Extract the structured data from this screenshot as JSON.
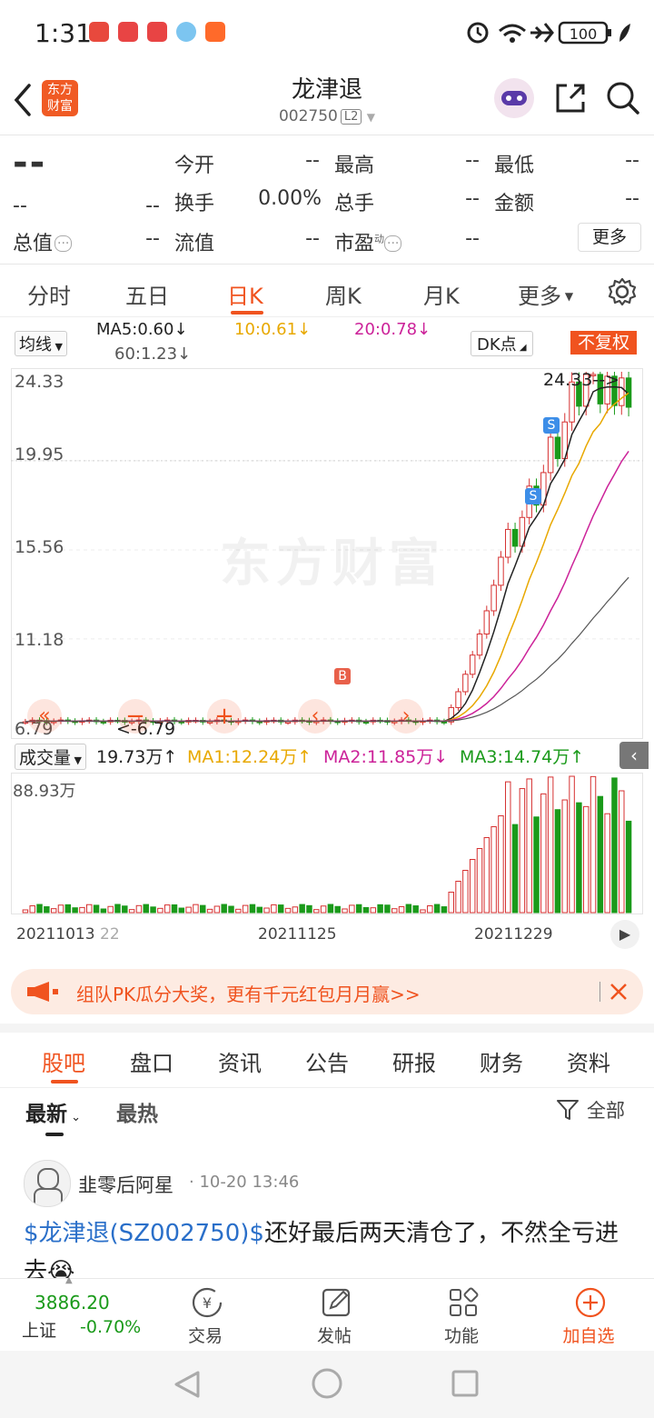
{
  "status_bar": {
    "time": "1:31",
    "battery": "100"
  },
  "header": {
    "title": "龙津退",
    "code": "002750",
    "level": "L2",
    "logo_text": "东方财富"
  },
  "quote": {
    "price": "--",
    "change": "--",
    "change_pct": "--",
    "market_cap_label": "总值",
    "market_cap": "--",
    "fields": [
      {
        "label": "今开",
        "value": "--"
      },
      {
        "label": "最高",
        "value": "--"
      },
      {
        "label": "最低",
        "value": "--"
      },
      {
        "label": "换手",
        "value": "0.00%"
      },
      {
        "label": "总手",
        "value": "--"
      },
      {
        "label": "金额",
        "value": "--"
      },
      {
        "label": "流值",
        "value": "--"
      },
      {
        "label": "市盈",
        "label_sup": "动",
        "value": "--"
      }
    ],
    "more_label": "更多"
  },
  "period_tabs": [
    "分时",
    "五日",
    "日K",
    "周K",
    "月K",
    "更多"
  ],
  "active_period": "日K",
  "ma_bar": {
    "selector": "均线",
    "ma5": "MA5:0.60↓",
    "ma10": "10:0.61↓",
    "ma20": "20:0.78↓",
    "ma60": "60:1.23↓",
    "dk_label": "DK点",
    "adjust_label": "不复权"
  },
  "kline": {
    "y_labels": [
      "24.33",
      "19.95",
      "15.56",
      "11.18",
      "6.79"
    ],
    "max_marker": "24.33",
    "min_marker": "6.79",
    "watermark": "东方财富",
    "signals": [
      "S",
      "S",
      "B"
    ]
  },
  "volume_bar": {
    "selector": "成交量",
    "value": "19.73万↑",
    "ma1": "MA1:12.24万↑",
    "ma2": "MA2:11.85万↓",
    "ma3": "MA3:14.74万↑",
    "y_max": "88.93万"
  },
  "dates": [
    "20211013",
    "22",
    "20211125",
    "20211229"
  ],
  "banner": {
    "text": "组队PK瓜分大奖，更有千元红包月月赢>>"
  },
  "bottom_tabs": [
    "股吧",
    "盘口",
    "资讯",
    "公告",
    "研报",
    "财务",
    "资料"
  ],
  "active_bottom_tab": "股吧",
  "sort": {
    "latest": "最新",
    "hot": "最热",
    "filter": "全部"
  },
  "post": {
    "user": "韭零后阿星",
    "time": "10-20 13:46",
    "tag": "$龙津退(SZ002750)$",
    "text": "还好最后两天清仓了，不然全亏进去😭"
  },
  "bottom_bar": {
    "index_value": "3886.20",
    "index_name": "上证",
    "index_change": "-0.70%",
    "items": [
      "交易",
      "发帖",
      "功能",
      "加自选"
    ]
  },
  "colors": {
    "accent": "#f0531f",
    "up": "#d63030",
    "down": "#1a9a1a",
    "ma10": "#e8a800",
    "ma20": "#cc2299"
  }
}
